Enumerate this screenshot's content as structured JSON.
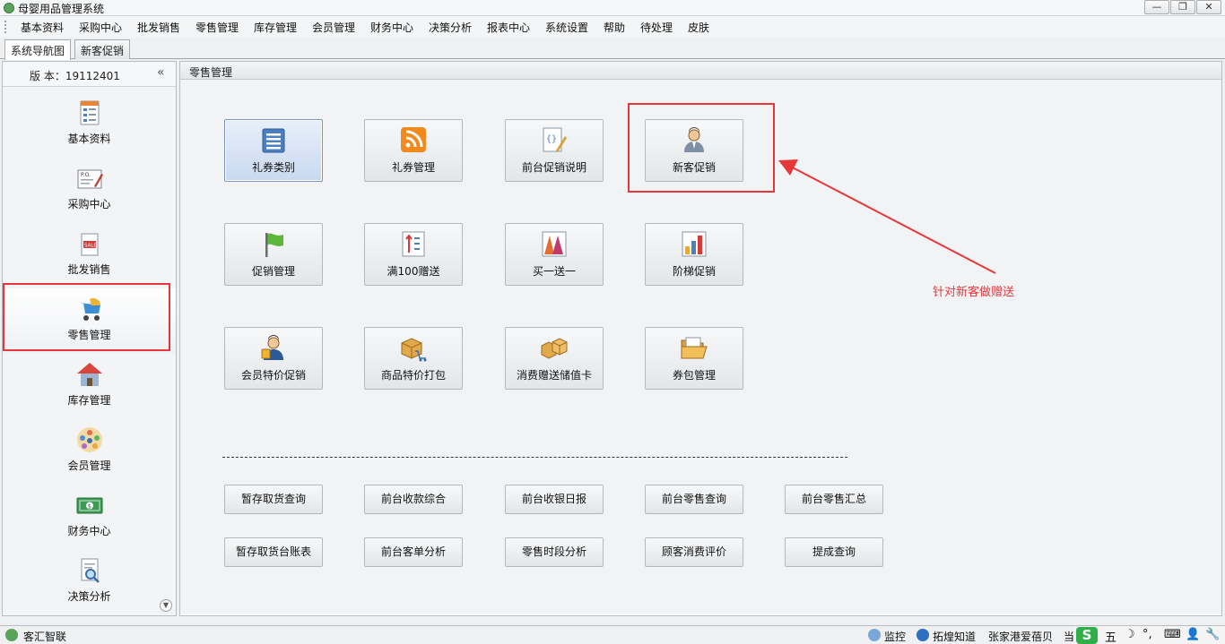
{
  "window": {
    "title": "母婴用品管理系统",
    "min": "—",
    "restore": "❐",
    "close": "✕"
  },
  "menu": [
    "基本资料",
    "采购中心",
    "批发销售",
    "零售管理",
    "库存管理",
    "会员管理",
    "财务中心",
    "决策分析",
    "报表中心",
    "系统设置",
    "帮助",
    "待处理",
    "皮肤"
  ],
  "tabs": [
    "系统导航图",
    "新客促销"
  ],
  "sidebar": {
    "version": "版 本：19112401",
    "collapse": "«",
    "items": [
      "基本资料",
      "采购中心",
      "批发销售",
      "零售管理",
      "库存管理",
      "会员管理",
      "财务中心",
      "决策分析"
    ],
    "scroll_down": "▼"
  },
  "main": {
    "header": "零售管理",
    "big_buttons": [
      "礼券类别",
      "礼券管理",
      "前台促销说明",
      "新客促销",
      "促销管理",
      "满100赠送",
      "买一送一",
      "阶梯促销",
      "会员特价促销",
      "商品特价打包",
      "消费赠送储值卡",
      "券包管理"
    ],
    "small_buttons": [
      "暂存取货查询",
      "前台收款综合",
      "前台收银日报",
      "前台零售查询",
      "前台零售汇总",
      "暂存取货台账表",
      "前台客单分析",
      "零售时段分析",
      "顾客消费评价",
      "提成查询"
    ]
  },
  "annotation": {
    "text": "针对新客做赠送",
    "color": "#e8373b"
  },
  "status": {
    "left": "客汇智联",
    "monitor": "监控",
    "help": "拓煌知道",
    "store": "张家港爱蓓贝",
    "cut": "当",
    "ime": [
      "五",
      "☽",
      "°,",
      "⌨",
      "👤",
      "🔧"
    ]
  }
}
